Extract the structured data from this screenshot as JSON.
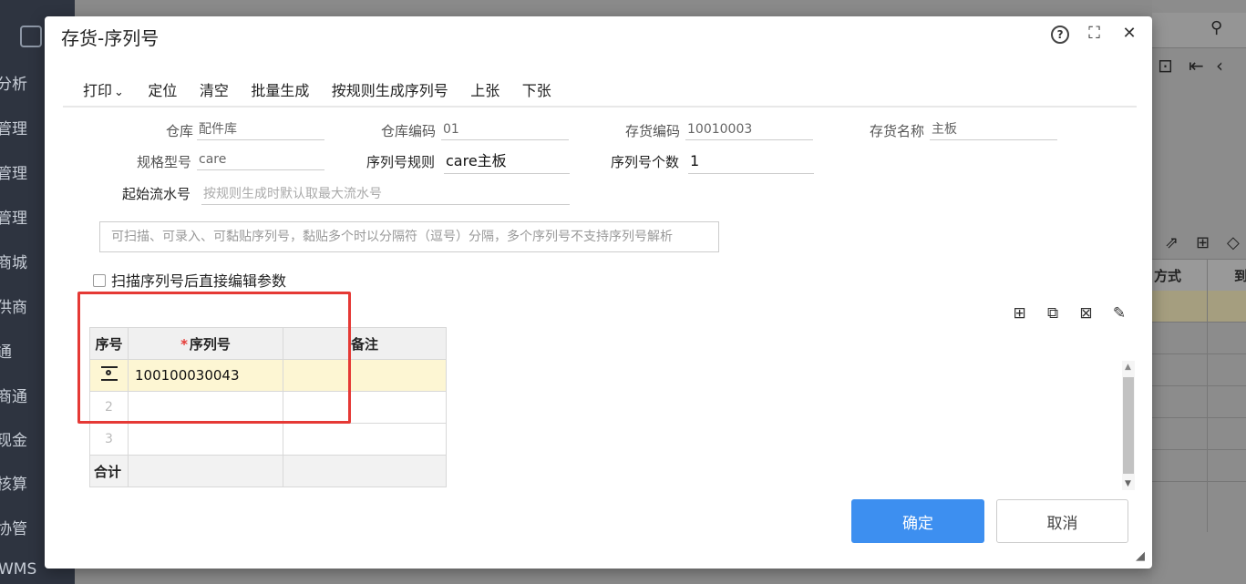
{
  "background": {
    "sidebar_items": [
      "分析",
      "管理",
      "管理",
      "管理",
      "商城",
      "供商",
      "通",
      "商通",
      "现金",
      "核算",
      "协管",
      "WMS"
    ],
    "right_header": [
      "方式",
      "到"
    ]
  },
  "dialog": {
    "title": "存货-序列号",
    "toolbar": [
      "打印",
      "定位",
      "清空",
      "批量生成",
      "按规则生成序列号",
      "上张",
      "下张"
    ],
    "print_caret": "⌄",
    "fields": {
      "warehouse_label": "仓库",
      "warehouse_value": "配件库",
      "warehouse_code_label": "仓库编码",
      "warehouse_code_value": "01",
      "inventory_code_label": "存货编码",
      "inventory_code_value": "10010003",
      "inventory_name_label": "存货名称",
      "inventory_name_value": "主板",
      "spec_label": "规格型号",
      "spec_value": "care",
      "rule_label": "序列号规则",
      "rule_value": "care主板",
      "count_label": "序列号个数",
      "count_value": "1",
      "start_label": "起始流水号",
      "start_placeholder": "按规则生成时默认取最大流水号"
    },
    "scan_placeholder": "可扫描、可录入、可黏贴序列号，黏贴多个时以分隔符（逗号）分隔，多个序列号不支持序列号解析",
    "checkbox_label": "扫描序列号后直接编辑参数",
    "table": {
      "headers": {
        "seq": "序号",
        "required_mark": "*",
        "serial": "序列号",
        "remark": "备注"
      },
      "rows": [
        {
          "seq": "",
          "serial": "100100030043",
          "remark": ""
        },
        {
          "seq": "2",
          "serial": "",
          "remark": ""
        },
        {
          "seq": "3",
          "serial": "",
          "remark": ""
        }
      ],
      "total_label": "合计"
    },
    "buttons": {
      "ok": "确定",
      "cancel": "取消"
    }
  }
}
